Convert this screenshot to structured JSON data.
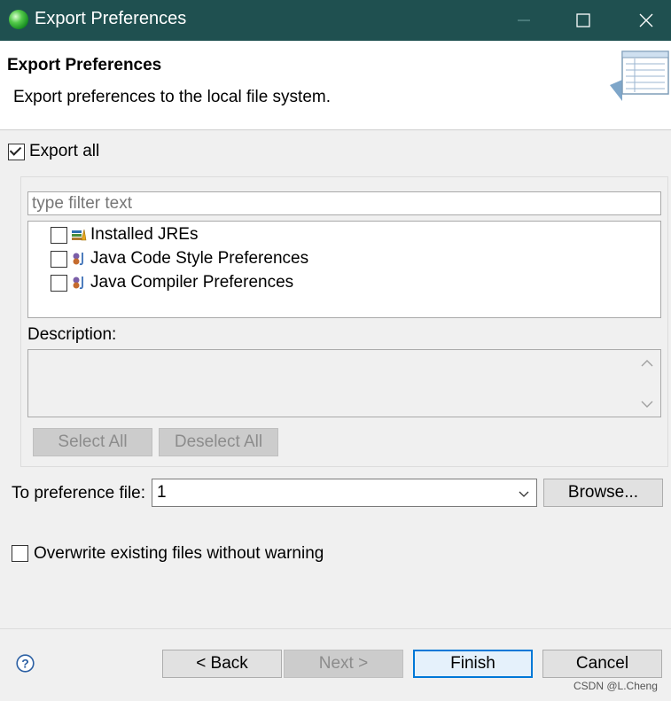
{
  "window": {
    "title": "Export Preferences",
    "controls": [
      "minimize-icon",
      "maximize-icon",
      "close-icon"
    ],
    "titlebar_color": "#1f5050"
  },
  "header": {
    "title": "Export Preferences",
    "description": "Export preferences to the local file system.",
    "banner_icon": "wizard-banner-icon"
  },
  "export_all": {
    "label": "Export all",
    "checked": true
  },
  "filter": {
    "placeholder": "type filter text",
    "value": ""
  },
  "tree": {
    "items": [
      {
        "label": "Installed JREs",
        "checked": false,
        "icon": "jre-icon"
      },
      {
        "label": "Java Code Style Preferences",
        "checked": false,
        "icon": "java-prefs-icon"
      },
      {
        "label": "Java Compiler Preferences",
        "checked": false,
        "icon": "java-prefs-icon"
      }
    ]
  },
  "description": {
    "label": "Description:",
    "text": ""
  },
  "selection_buttons": {
    "select_all": "Select All",
    "deselect_all": "Deselect All"
  },
  "preference_file": {
    "label": "To preference file:",
    "value": "1",
    "browse_label": "Browse..."
  },
  "overwrite": {
    "label": "Overwrite existing files without warning",
    "checked": false
  },
  "footer": {
    "help_icon": "help-icon",
    "back_label": "< Back",
    "next_label": "Next >",
    "finish_label": "Finish",
    "cancel_label": "Cancel"
  },
  "watermark": "CSDN @L.Cheng",
  "colors": {
    "accent": "#0078d7",
    "titlebar": "#1f5050"
  }
}
